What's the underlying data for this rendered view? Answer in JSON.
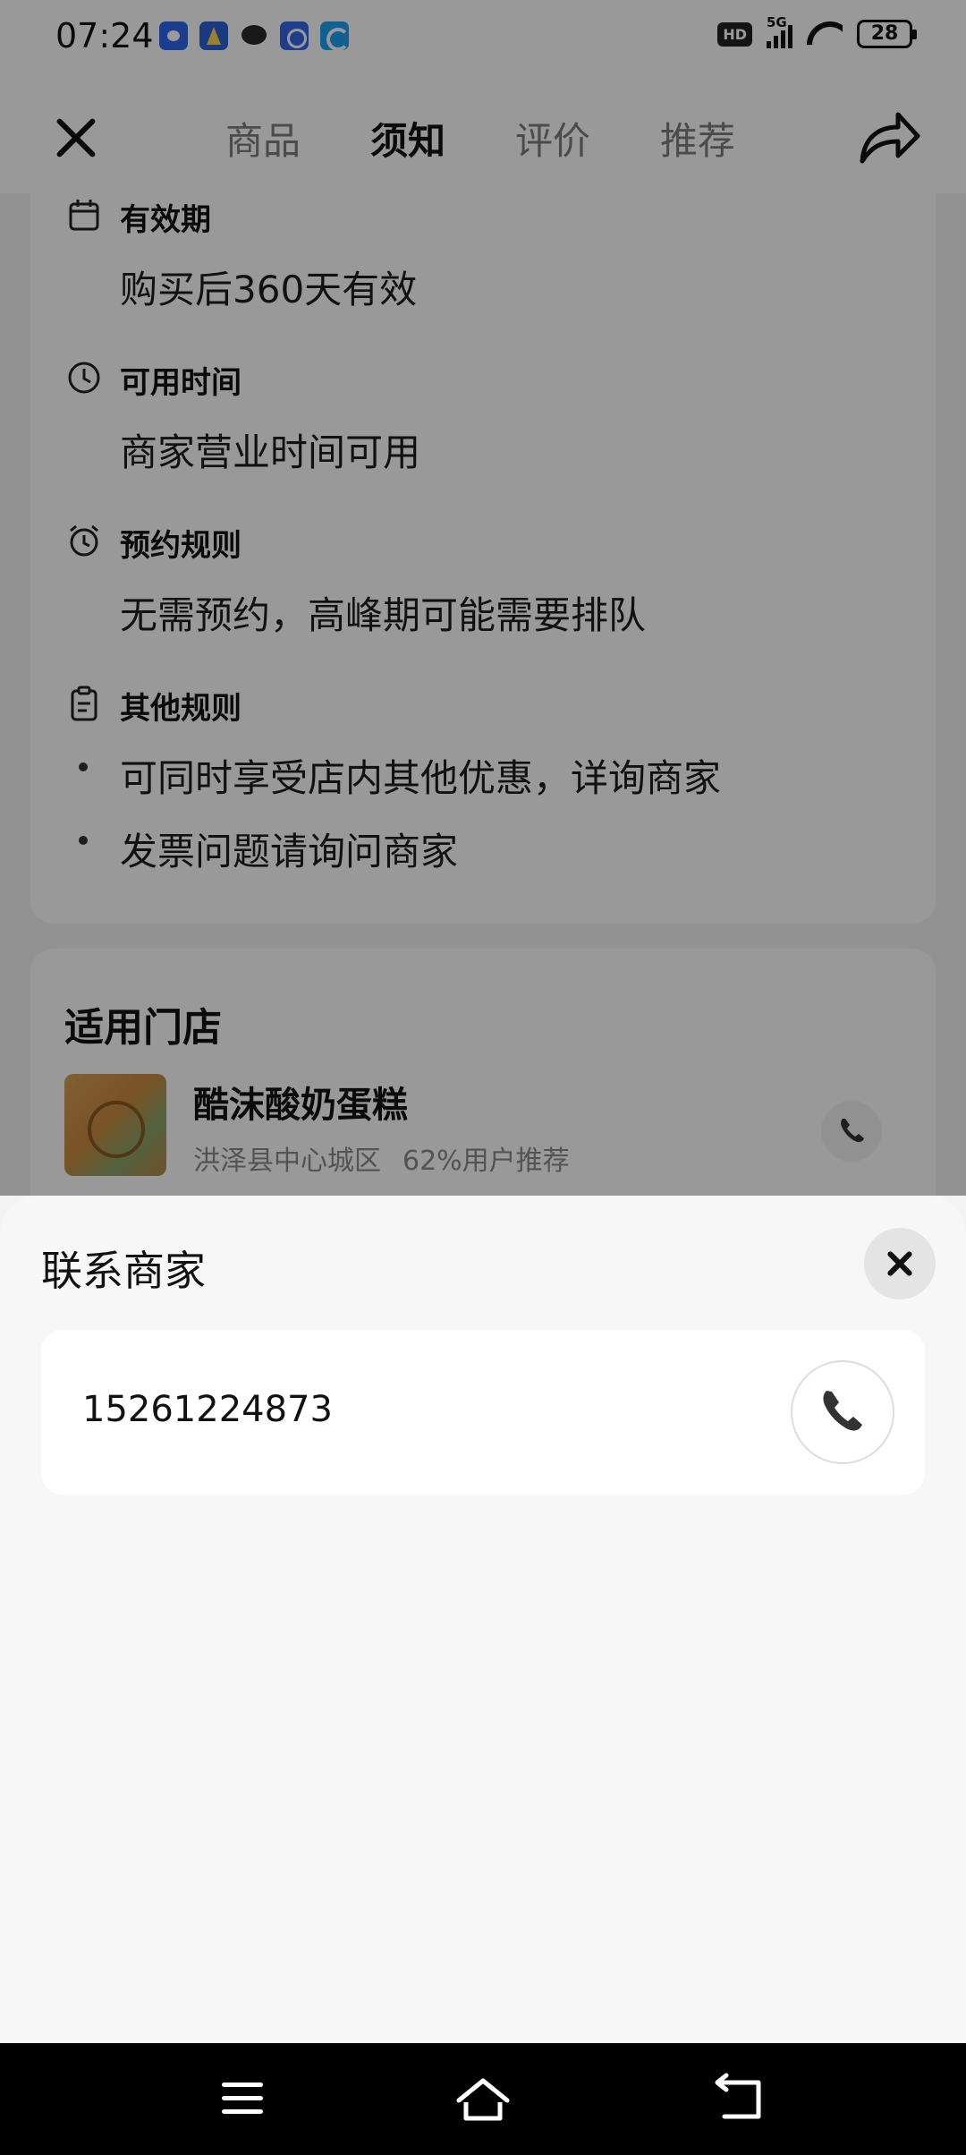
{
  "status_bar": {
    "time": "07:24",
    "network": "5G",
    "hd_label": "HD",
    "battery": "28",
    "app_icons": [
      "baidu-icon",
      "app-k-icon",
      "message-bubble-icon",
      "qq-icon",
      "browser-icon"
    ]
  },
  "header": {
    "tabs": [
      {
        "label": "商品",
        "active": false
      },
      {
        "label": "须知",
        "active": true
      },
      {
        "label": "评价",
        "active": false
      },
      {
        "label": "推荐",
        "active": false
      }
    ]
  },
  "notice": {
    "validity": {
      "title": "有效期",
      "text": "购买后360天有效"
    },
    "available_time": {
      "title": "可用时间",
      "text": "商家营业时间可用"
    },
    "booking": {
      "title": "预约规则",
      "text": "无需预约，高峰期可能需要排队"
    },
    "other": {
      "title": "其他规则",
      "items": [
        "可同时享受店内其他优惠，详询商家",
        "发票问题请询问商家"
      ]
    }
  },
  "store": {
    "section_title": "适用门店",
    "name": "酷沫酸奶蛋糕",
    "area": "洪泽县中心城区",
    "recommend": "62%用户推荐"
  },
  "contact_sheet": {
    "title": "联系商家",
    "phone": "15261224873"
  },
  "colors": {
    "background": "#f3f3f3",
    "card": "#ffffff",
    "overlay": "rgba(0,0,0,0.40)",
    "sheet": "#f7f7f7",
    "text_primary": "#111111",
    "text_muted": "#8a8a8a",
    "tab_inactive": "#7d7d7d"
  }
}
